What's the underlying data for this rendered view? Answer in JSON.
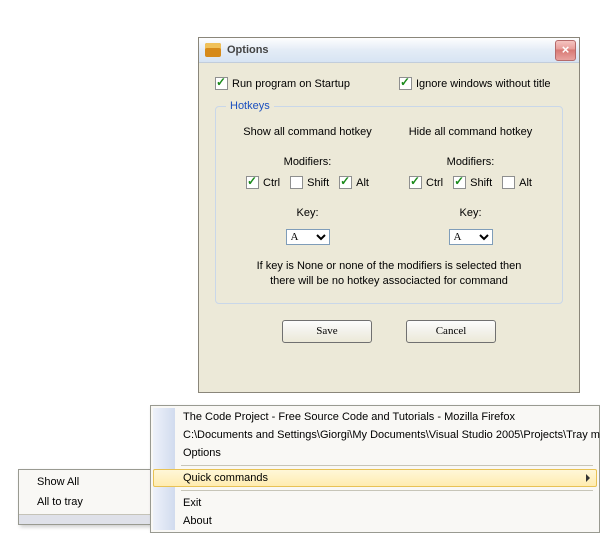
{
  "dialog": {
    "title": "Options",
    "run_on_startup_label": "Run program on Startup",
    "ignore_untitled_label": "Ignore windows without title",
    "run_on_startup_checked": true,
    "ignore_untitled_checked": true,
    "hotkeys_legend": "Hotkeys",
    "show_label": "Show all command hotkey",
    "hide_label": "Hide all command hotkey",
    "modifiers_label": "Modifiers:",
    "ctrl_label": "Ctrl",
    "shift_label": "Shift",
    "alt_label": "Alt",
    "key_label": "Key:",
    "show": {
      "ctrl": true,
      "shift": false,
      "alt": true,
      "key": "A"
    },
    "hide": {
      "ctrl": true,
      "shift": true,
      "alt": false,
      "key": "A"
    },
    "note_line1": "If key is None or none of the modifiers is selected then",
    "note_line2": "there will be no hotkey associacted for command",
    "save_label": "Save",
    "cancel_label": "Cancel"
  },
  "small_menu": {
    "show_all": "Show All",
    "all_to_tray": "All to tray"
  },
  "main_menu": {
    "item1": "The Code Project - Free Source Code and Tutorials - Mozilla Firefox",
    "item2": "C:\\Documents and Settings\\Giorgi\\My Documents\\Visual Studio 2005\\Projects\\Tray minimizer\\Tray m",
    "item3": "Options",
    "item4": "Quick commands",
    "item5": "Exit",
    "item6": "About"
  }
}
